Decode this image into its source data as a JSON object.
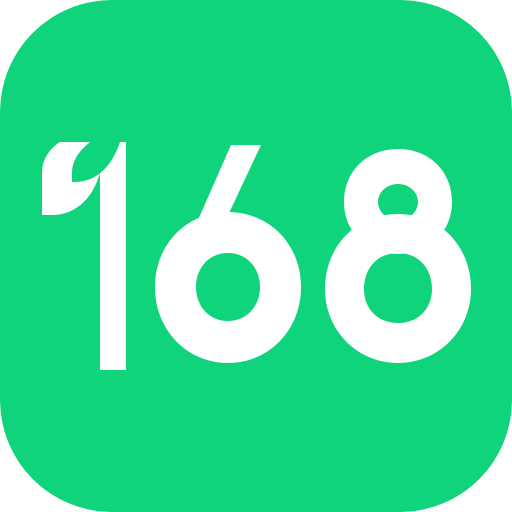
{
  "logo": {
    "text": "168",
    "background_color": "#10D47B",
    "foreground_color": "#FFFFFF"
  }
}
